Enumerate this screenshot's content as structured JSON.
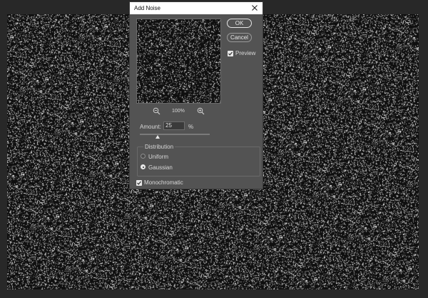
{
  "dialog": {
    "title": "Add Noise",
    "ok_label": "OK",
    "cancel_label": "Cancel",
    "preview": {
      "label": "Preview",
      "checked": true
    },
    "zoom_level": "100%",
    "amount": {
      "label": "Amount:",
      "value": "25",
      "unit": "%",
      "slider_fraction": 0.25
    },
    "distribution": {
      "label": "Distribution",
      "options": [
        {
          "label": "Uniform",
          "selected": false
        },
        {
          "label": "Gaussian",
          "selected": true
        }
      ]
    },
    "monochromatic": {
      "label": "Monochromatic",
      "checked": true
    }
  },
  "icons": {
    "close": "close-icon",
    "zoom_out": "zoom-out-icon",
    "zoom_in": "zoom-in-icon",
    "checkmark": "checkmark-icon"
  },
  "colors": {
    "dialog_bg": "#535353",
    "workspace_bg": "#282828",
    "canvas_bg": "#0f0f0f",
    "noise": "#ffffff"
  }
}
